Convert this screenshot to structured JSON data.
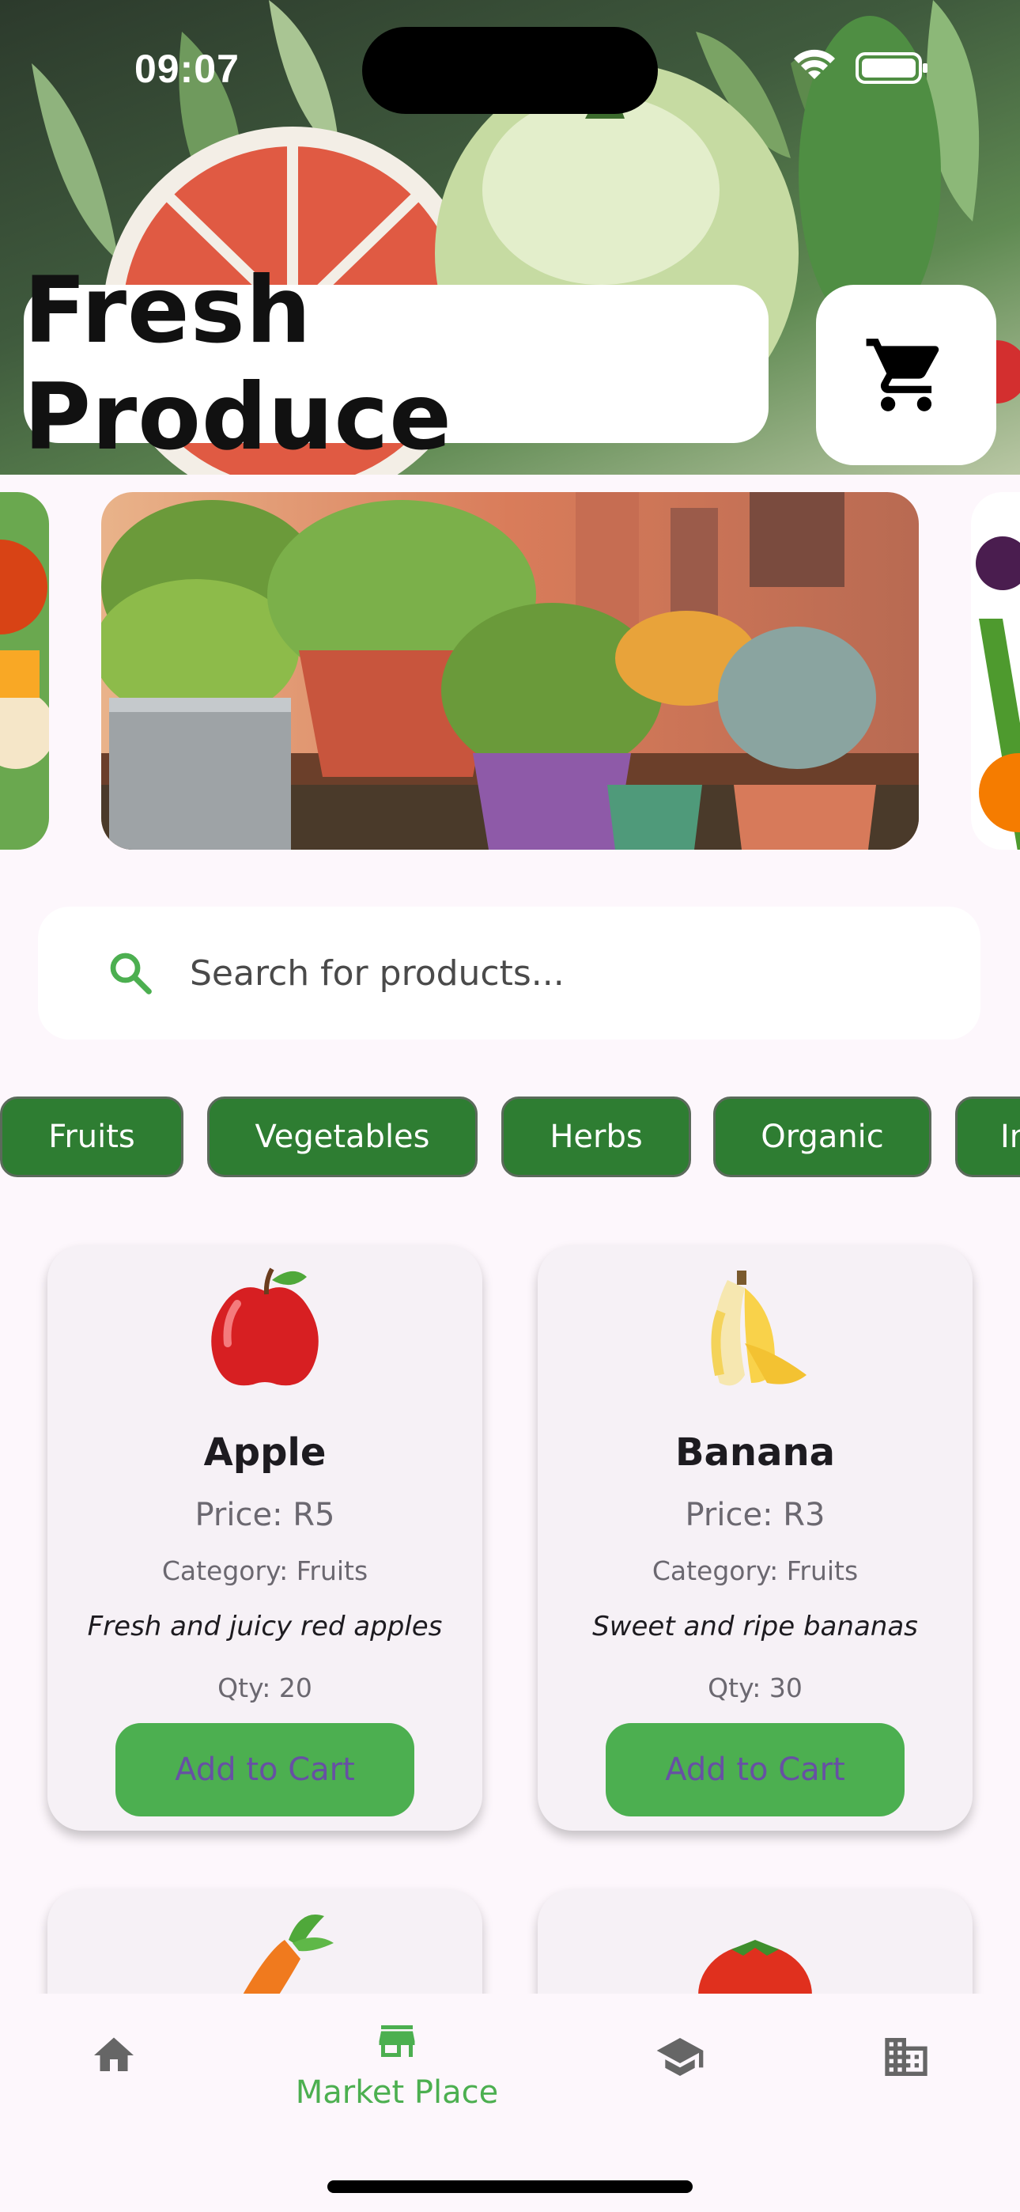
{
  "status_bar": {
    "time": "09:07"
  },
  "header": {
    "title": "Fresh Produce",
    "cart_icon": "cart-icon"
  },
  "search": {
    "placeholder": "Search for products..."
  },
  "categories": [
    "Fruits",
    "Vegetables",
    "Herbs",
    "Organic",
    "In"
  ],
  "products": [
    {
      "emoji": "🍎",
      "name": "Apple",
      "price": "Price: R5",
      "category": "Category: Fruits",
      "description": "Fresh and juicy red apples",
      "qty": "Qty: 20",
      "button": "Add to Cart"
    },
    {
      "emoji": "🍌",
      "name": "Banana",
      "price": "Price: R3",
      "category": "Category: Fruits",
      "description": "Sweet and ripe bananas",
      "qty": "Qty: 30",
      "button": "Add to Cart"
    },
    {
      "emoji": "🥕"
    },
    {
      "emoji": "🍅"
    }
  ],
  "bottom_nav": {
    "items": [
      {
        "icon": "home-icon",
        "label": ""
      },
      {
        "icon": "storefront-icon",
        "label": "Market Place",
        "active": true
      },
      {
        "icon": "school-icon",
        "label": ""
      },
      {
        "icon": "business-icon",
        "label": ""
      }
    ]
  },
  "colors": {
    "primary_green": "#2e7d32",
    "button_green": "#4caf50",
    "button_text": "#6750a4",
    "background": "#fdf7fc"
  }
}
